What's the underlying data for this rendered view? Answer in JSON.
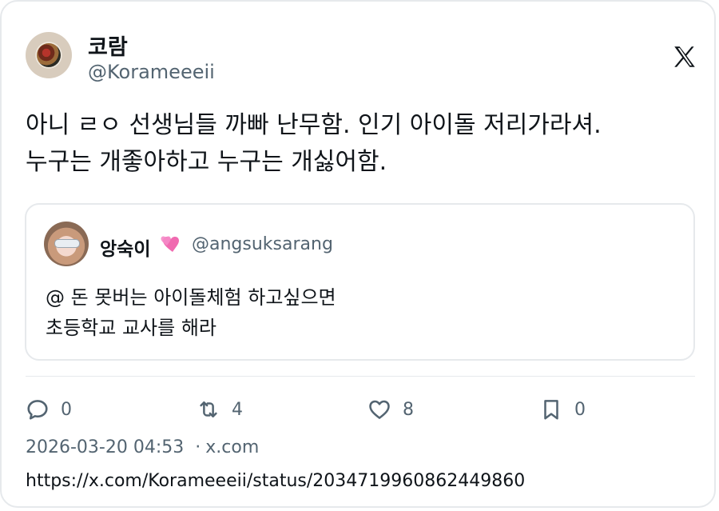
{
  "tweet": {
    "author": {
      "name": "코람",
      "handle": "@Koramееeii"
    },
    "text_lines": [
      "아니 ㄹㅇ 선생님들 까빠 난무함. 인기 아이돌 저리가라셔.",
      "누구는 개좋아하고 누구는 개싫어함."
    ],
    "quoted": {
      "name": "앙숙이",
      "emoji": "💞",
      "handle": "@angsuksarang",
      "text_lines": [
        "@ 돈 못버는 아이돌체험 하고싶으면",
        "초등학교 교사를 해라"
      ]
    },
    "actions": {
      "reply_count": "0",
      "retweet_count": "4",
      "like_count": "8",
      "bookmark_count": "0"
    },
    "timestamp": "2026-03-20 04:53",
    "source": "x.com",
    "url": "https://x.com/Korameeeii/status/2034719960862449860"
  },
  "icons": {
    "brand": "x-logo-icon",
    "reply": "reply-icon",
    "retweet": "retweet-icon",
    "like": "heart-icon",
    "bookmark": "bookmark-icon"
  },
  "colors": {
    "text": "#0f1419",
    "secondary": "#536471",
    "border": "#e6e9ec",
    "heart_emoji": "#f06ab0"
  }
}
